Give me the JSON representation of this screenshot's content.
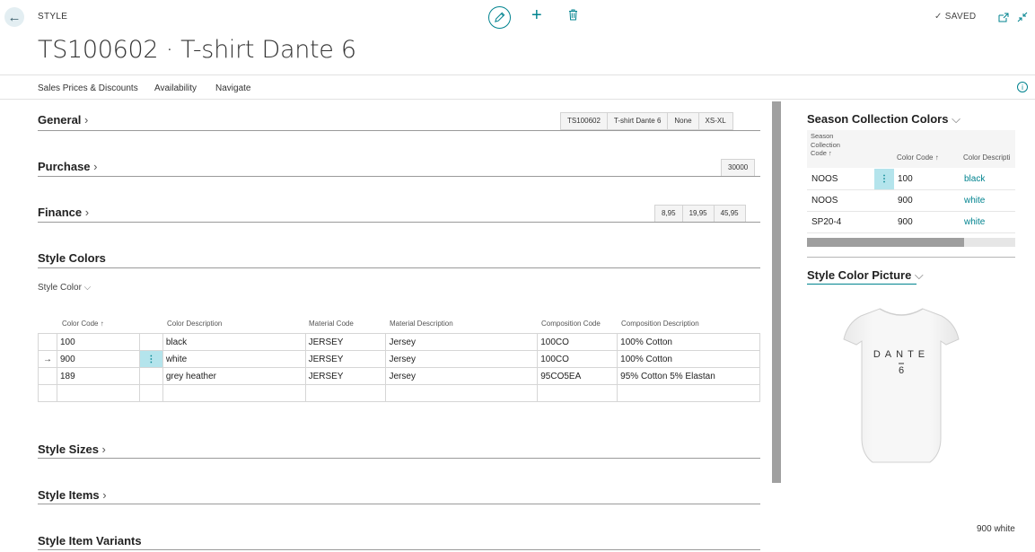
{
  "header": {
    "type_label": "STYLE",
    "title": "TS100602 · T-shirt Dante 6",
    "saved_label": "SAVED"
  },
  "actions": [
    "Sales Prices & Discounts",
    "Availability",
    "Navigate"
  ],
  "sections": {
    "general": {
      "title": "General",
      "chips": [
        "TS100602",
        "T-shirt Dante 6",
        "None",
        "XS-XL"
      ]
    },
    "purchase": {
      "title": "Purchase",
      "chips": [
        "30000"
      ]
    },
    "finance": {
      "title": "Finance",
      "chips": [
        "8,95",
        "19,95",
        "45,95"
      ]
    },
    "style_colors": {
      "title": "Style Colors",
      "sub_label": "Style Color"
    },
    "style_sizes": {
      "title": "Style Sizes"
    },
    "style_items": {
      "title": "Style Items"
    },
    "style_item_variants": {
      "title": "Style Item Variants"
    }
  },
  "style_colors_grid": {
    "columns": [
      "Color Code ↑",
      "Color Description",
      "Material Code",
      "Material Description",
      "Composition Code",
      "Composition Description"
    ],
    "rows": [
      {
        "code": "100",
        "desc": "black",
        "mat_code": "JERSEY",
        "mat_desc": "Jersey",
        "comp_code": "100CO",
        "comp_desc": "100% Cotton"
      },
      {
        "code": "900",
        "desc": "white",
        "mat_code": "JERSEY",
        "mat_desc": "Jersey",
        "comp_code": "100CO",
        "comp_desc": "100% Cotton"
      },
      {
        "code": "189",
        "desc": "grey heather",
        "mat_code": "JERSEY",
        "mat_desc": "Jersey",
        "comp_code": "95CO5EA",
        "comp_desc": "95% Cotton 5% Elastan"
      }
    ]
  },
  "season_collection_colors": {
    "title": "Season Collection Colors",
    "columns": [
      "Season Collection Code ↑",
      "Color Code ↑",
      "Color Descripti"
    ],
    "col1_lines": [
      "Season",
      "Collection",
      "Code ↑"
    ],
    "rows": [
      {
        "season": "NOOS",
        "code": "100",
        "desc": "black"
      },
      {
        "season": "NOOS",
        "code": "900",
        "desc": "white"
      },
      {
        "season": "SP20-4",
        "code": "900",
        "desc": "white"
      }
    ]
  },
  "style_color_picture": {
    "title": "Style Color Picture",
    "shirt_text_line1": "DANTE",
    "shirt_text_line2": "6",
    "caption": "900 white"
  },
  "colors": {
    "accent": "#00838f",
    "row_highlight": "#b4e4ec"
  }
}
